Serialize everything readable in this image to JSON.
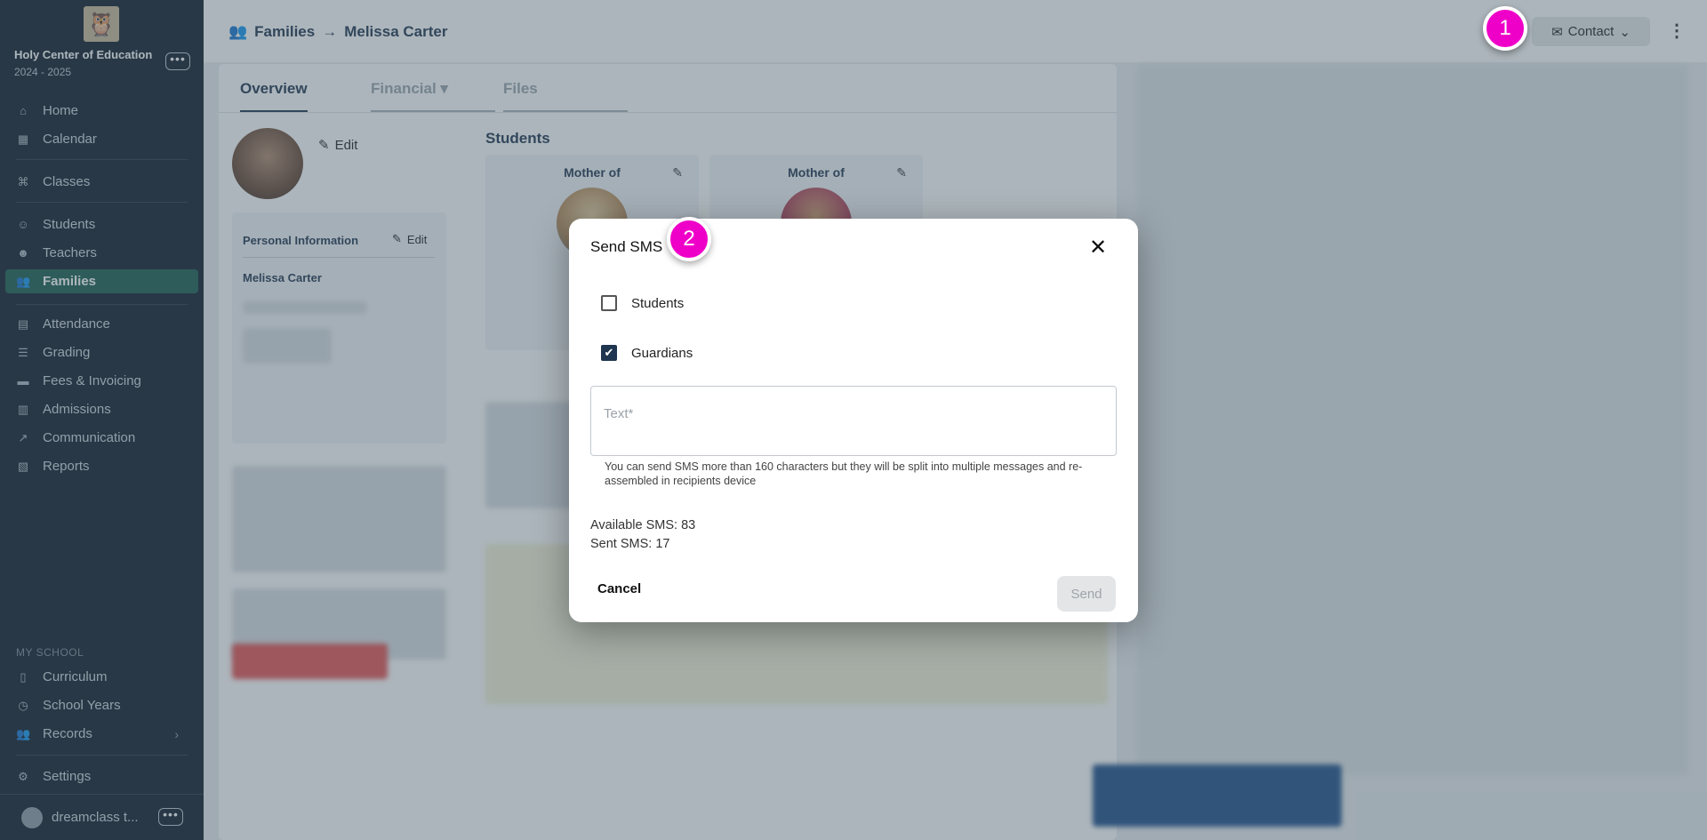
{
  "sidebar": {
    "school_name": "Holy Center of Education",
    "school_year": "2024 - 2025",
    "school_menu_label": "•••",
    "items": [
      {
        "label": "Home"
      },
      {
        "label": "Calendar"
      },
      {
        "label": "Classes"
      },
      {
        "label": "Students"
      },
      {
        "label": "Teachers"
      },
      {
        "label": "Families"
      },
      {
        "label": "Attendance"
      },
      {
        "label": "Grading"
      },
      {
        "label": "Fees & Invoicing"
      },
      {
        "label": "Admissions"
      },
      {
        "label": "Communication"
      },
      {
        "label": "Reports"
      }
    ],
    "section_label": "MY SCHOOL",
    "my_school_items": [
      {
        "label": "Curriculum"
      },
      {
        "label": "School Years"
      },
      {
        "label": "Records"
      },
      {
        "label": "Settings"
      }
    ],
    "user_name": "dreamclass t...",
    "user_menu_label": "•••"
  },
  "header": {
    "section": "Families",
    "arrow": "→",
    "person": "Melissa Carter",
    "contact_label": "Contact"
  },
  "tabs": [
    {
      "label": "Overview"
    },
    {
      "label": "Financial"
    },
    {
      "label": "Files"
    }
  ],
  "profile": {
    "edit_label": "Edit",
    "personal_info_title": "Personal Information",
    "personal_edit_label": "Edit",
    "name": "Melissa Carter"
  },
  "students": {
    "heading": "Students",
    "cards": [
      {
        "relation": "Mother of"
      },
      {
        "relation": "Mother of"
      }
    ]
  },
  "modal": {
    "title": "Send SMS",
    "options": [
      {
        "label": "Students",
        "checked": false
      },
      {
        "label": "Guardians",
        "checked": true
      }
    ],
    "text_placeholder": "Text*",
    "helper": "You can send SMS more than 160 characters but they will be split into multiple messages and re-assembled in recipients device",
    "available": "Available SMS: 83",
    "sent": "Sent SMS: 17",
    "cancel_label": "Cancel",
    "send_label": "Send"
  },
  "badges": [
    {
      "label": "1"
    },
    {
      "label": "2"
    }
  ],
  "colors": {
    "sidebar_bg": "#0f1d2b",
    "active_nav": "#1b5e4f",
    "badge": "#ef00c8",
    "brand_text": "#1f3550"
  }
}
